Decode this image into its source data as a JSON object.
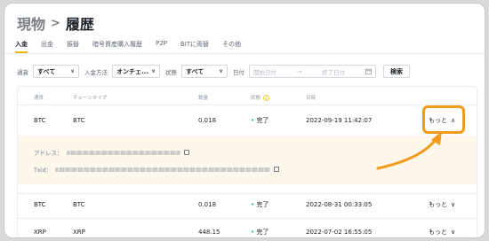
{
  "header": {
    "title": "現物",
    "separator": ">",
    "current": "履歴"
  },
  "tabs": [
    {
      "label": "入金",
      "active": true
    },
    {
      "label": "出金",
      "active": false
    },
    {
      "label": "振替",
      "active": false
    },
    {
      "label": "暗号資産購入履歴",
      "active": false
    },
    {
      "label": "P2P",
      "active": false
    },
    {
      "label": "BITに両替",
      "active": false
    },
    {
      "label": "その他",
      "active": false
    }
  ],
  "filters": {
    "currency_label": "通貨",
    "currency_value": "すべて",
    "method_label": "入金方法",
    "method_value": "オンチェ...",
    "status_label": "状態",
    "status_value": "すべて",
    "date_label": "日付",
    "start_placeholder": "開始日付",
    "end_placeholder": "終了日付",
    "search_label": "検索"
  },
  "table": {
    "headers": {
      "coin": "通貨",
      "chain": "チェーンタイプ",
      "amount": "数量",
      "status": "状態",
      "time": "日時"
    },
    "rows": [
      {
        "coin": "BTC",
        "chain": "BTC",
        "amount": "0.018",
        "status": "完了",
        "time": "2022-09-19 11:42:07",
        "more": "もっと"
      },
      {
        "coin": "BTC",
        "chain": "BTC",
        "amount": "0.018",
        "status": "完了",
        "time": "2022-08-31 00:33:05",
        "more": "もっと"
      },
      {
        "coin": "XRP",
        "chain": "XRP",
        "amount": "448.15",
        "status": "完了",
        "time": "2022-07-02 16:55:05",
        "more": "もっと"
      }
    ],
    "detail": {
      "address_label": "アドレス：",
      "txid_label": "Txid："
    }
  },
  "colors": {
    "accent": "#f0b90b",
    "highlight": "#f29b1d",
    "success": "#0ecb81",
    "detail_bg": "#fdf7ec"
  }
}
